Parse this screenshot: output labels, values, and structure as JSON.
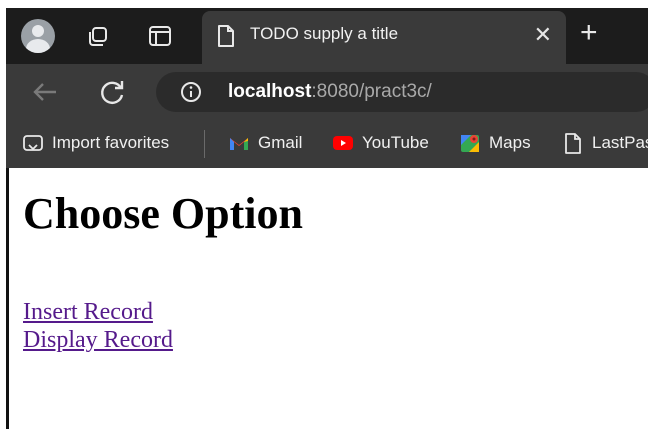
{
  "browser": {
    "tab": {
      "title": "TODO supply a title",
      "close_label": "✕"
    },
    "new_tab_label": "+",
    "address": {
      "host": "localhost",
      "rest": ":8080/pract3c/"
    },
    "bookmarks": [
      {
        "label": "Import favorites",
        "icon": "import-icon"
      },
      {
        "label": "Gmail",
        "icon": "gmail-icon"
      },
      {
        "label": "YouTube",
        "icon": "youtube-icon"
      },
      {
        "label": "Maps",
        "icon": "maps-icon"
      },
      {
        "label": "LastPas",
        "icon": "page-icon"
      }
    ]
  },
  "page": {
    "title": "Choose Option",
    "links": [
      {
        "label": "Insert Record"
      },
      {
        "label": "Display Record"
      }
    ]
  },
  "colors": {
    "link_visited": "#551a8b",
    "chrome_dark": "#202124",
    "tab_active": "#3a3a3a"
  }
}
